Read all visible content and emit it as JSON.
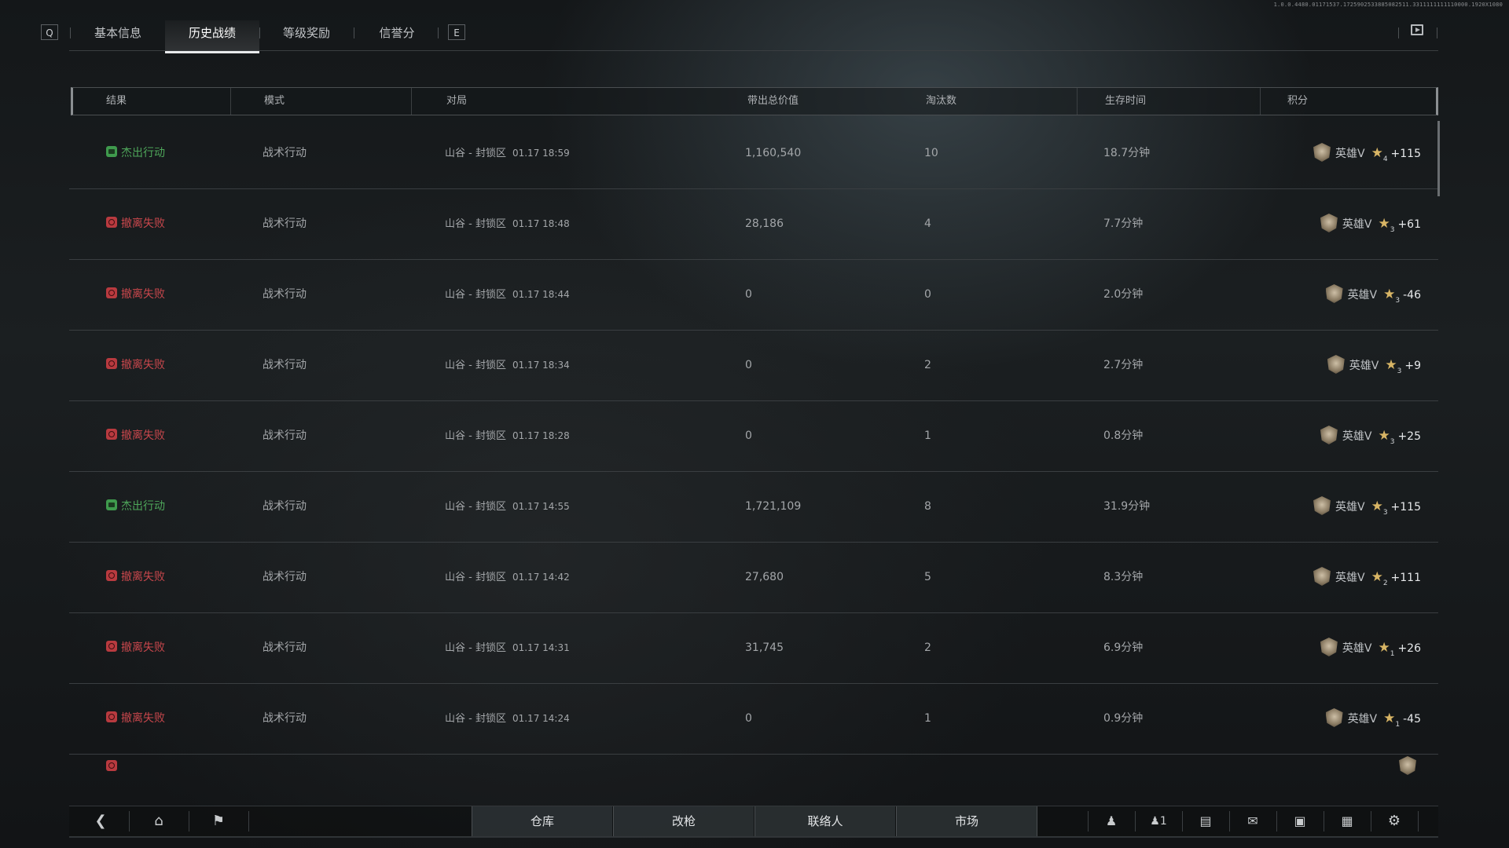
{
  "build_info": "1.0.0.4480.01171537.1725902533885082511.3311111111110000.1920X1080",
  "tabs": {
    "left_key": "Q",
    "right_key": "E",
    "items": [
      {
        "label": "基本信息"
      },
      {
        "label": "历史战绩"
      },
      {
        "label": "等级奖励"
      },
      {
        "label": "信誉分"
      }
    ],
    "active": "历史战绩"
  },
  "table": {
    "headers": [
      "结果",
      "模式",
      "对局",
      "带出总价值",
      "淘汰数",
      "生存时间",
      "积分"
    ],
    "rows": [
      {
        "result": "杰出行动",
        "status": "success",
        "mode": "战术行动",
        "map": "山谷 - 封锁区",
        "time": "01.17 18:59",
        "value": "1,160,540",
        "kills": "10",
        "survival": "18.7分钟",
        "rank": "英雄V",
        "stars": "4",
        "points": "+115"
      },
      {
        "result": "撤离失败",
        "status": "fail",
        "mode": "战术行动",
        "map": "山谷 - 封锁区",
        "time": "01.17 18:48",
        "value": "28,186",
        "kills": "4",
        "survival": "7.7分钟",
        "rank": "英雄V",
        "stars": "3",
        "points": "+61"
      },
      {
        "result": "撤离失败",
        "status": "fail",
        "mode": "战术行动",
        "map": "山谷 - 封锁区",
        "time": "01.17 18:44",
        "value": "0",
        "kills": "0",
        "survival": "2.0分钟",
        "rank": "英雄V",
        "stars": "3",
        "points": "-46"
      },
      {
        "result": "撤离失败",
        "status": "fail",
        "mode": "战术行动",
        "map": "山谷 - 封锁区",
        "time": "01.17 18:34",
        "value": "0",
        "kills": "2",
        "survival": "2.7分钟",
        "rank": "英雄V",
        "stars": "3",
        "points": "+9"
      },
      {
        "result": "撤离失败",
        "status": "fail",
        "mode": "战术行动",
        "map": "山谷 - 封锁区",
        "time": "01.17 18:28",
        "value": "0",
        "kills": "1",
        "survival": "0.8分钟",
        "rank": "英雄V",
        "stars": "3",
        "points": "+25"
      },
      {
        "result": "杰出行动",
        "status": "success",
        "mode": "战术行动",
        "map": "山谷 - 封锁区",
        "time": "01.17 14:55",
        "value": "1,721,109",
        "kills": "8",
        "survival": "31.9分钟",
        "rank": "英雄V",
        "stars": "3",
        "points": "+115"
      },
      {
        "result": "撤离失败",
        "status": "fail",
        "mode": "战术行动",
        "map": "山谷 - 封锁区",
        "time": "01.17 14:42",
        "value": "27,680",
        "kills": "5",
        "survival": "8.3分钟",
        "rank": "英雄V",
        "stars": "2",
        "points": "+111"
      },
      {
        "result": "撤离失败",
        "status": "fail",
        "mode": "战术行动",
        "map": "山谷 - 封锁区",
        "time": "01.17 14:31",
        "value": "31,745",
        "kills": "2",
        "survival": "6.9分钟",
        "rank": "英雄V",
        "stars": "1",
        "points": "+26"
      },
      {
        "result": "撤离失败",
        "status": "fail",
        "mode": "战术行动",
        "map": "山谷 - 封锁区",
        "time": "01.17 14:24",
        "value": "0",
        "kills": "1",
        "survival": "0.9分钟",
        "rank": "英雄V",
        "stars": "1",
        "points": "-45"
      }
    ]
  },
  "bottom_nav": {
    "items": [
      {
        "label": "仓库"
      },
      {
        "label": "改枪"
      },
      {
        "label": "联络人"
      },
      {
        "label": "市场"
      }
    ],
    "friends_count": "1"
  },
  "colors": {
    "success": "#4ea65a",
    "fail": "#c8474c",
    "star": "#d8b565"
  },
  "icons": [
    "back-arrow-icon",
    "home-icon",
    "flag-icon",
    "friends-search-icon",
    "team-icon",
    "chat-icon",
    "mail-icon",
    "lock-bag-icon",
    "notes-icon",
    "gear-icon",
    "replay-icon"
  ]
}
